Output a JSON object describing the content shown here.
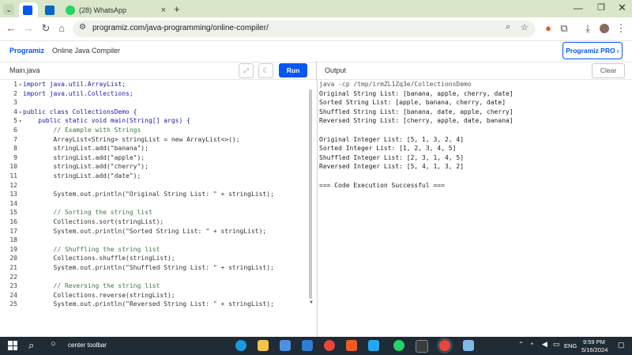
{
  "browser": {
    "tabs": [
      {
        "title": ""
      },
      {
        "title": ""
      },
      {
        "title": "(28) WhatsApp"
      }
    ],
    "new_tab": "+",
    "url": "programiz.com/java-programming/online-compiler/"
  },
  "site": {
    "logo": "Programiz",
    "subtitle": "Online Java Compiler",
    "pro_button": "Programiz PRO ›"
  },
  "editor": {
    "filename": "Main.java",
    "run_label": "Run",
    "lines": [
      {
        "n": "1",
        "fold": "▾",
        "code": "import java.util.ArrayList;"
      },
      {
        "n": "2",
        "fold": "",
        "code": "import java.util.Collections;"
      },
      {
        "n": "3",
        "fold": "",
        "code": ""
      },
      {
        "n": "4",
        "fold": "▾",
        "code": "public class CollectionsDemo {"
      },
      {
        "n": "5",
        "fold": "▾",
        "code": "    public static void main(String[] args) {"
      },
      {
        "n": "6",
        "fold": "",
        "code": "        // Example with Strings"
      },
      {
        "n": "7",
        "fold": "",
        "code": "        ArrayList<String> stringList = new ArrayList<>();"
      },
      {
        "n": "8",
        "fold": "",
        "code": "        stringList.add(\"banana\");"
      },
      {
        "n": "9",
        "fold": "",
        "code": "        stringList.add(\"apple\");"
      },
      {
        "n": "10",
        "fold": "",
        "code": "        stringList.add(\"cherry\");"
      },
      {
        "n": "11",
        "fold": "",
        "code": "        stringList.add(\"date\");"
      },
      {
        "n": "12",
        "fold": "",
        "code": ""
      },
      {
        "n": "13",
        "fold": "",
        "code": "        System.out.println(\"Original String List: \" + stringList);"
      },
      {
        "n": "14",
        "fold": "",
        "code": ""
      },
      {
        "n": "15",
        "fold": "",
        "code": "        // Sorting the string list"
      },
      {
        "n": "16",
        "fold": "",
        "code": "        Collections.sort(stringList);"
      },
      {
        "n": "17",
        "fold": "",
        "code": "        System.out.println(\"Sorted String List: \" + stringList);"
      },
      {
        "n": "18",
        "fold": "",
        "code": ""
      },
      {
        "n": "19",
        "fold": "",
        "code": "        // Shuffling the string list"
      },
      {
        "n": "20",
        "fold": "",
        "code": "        Collections.shuffle(stringList);"
      },
      {
        "n": "21",
        "fold": "",
        "code": "        System.out.println(\"Shuffled String List: \" + stringList);"
      },
      {
        "n": "22",
        "fold": "",
        "code": ""
      },
      {
        "n": "23",
        "fold": "",
        "code": "        // Reversing the string list"
      },
      {
        "n": "24",
        "fold": "",
        "code": "        Collections.reverse(stringList);"
      },
      {
        "n": "25",
        "fold": "",
        "code": "        System.out.println(\"Reversed String List: \" + stringList);"
      }
    ]
  },
  "output": {
    "label": "Output",
    "clear_label": "Clear",
    "lines": [
      "java -cp /tmp/irmZL1Zq3e/CollectionsDemo",
      "Original String List: [banana, apple, cherry, date]",
      "Sorted String List: [apple, banana, cherry, date]",
      "Shuffled String List: [banana, date, apple, cherry]",
      "Reversed String List: [cherry, apple, date, banana]",
      "",
      "Original Integer List: [5, 1, 3, 2, 4]",
      "Sorted Integer List: [1, 2, 3, 4, 5]",
      "Shuffled Integer List: [2, 3, 1, 4, 5]",
      "Reversed Integer List: [5, 4, 1, 3, 2]",
      "",
      "=== Code Execution Successful ==="
    ]
  },
  "taskbar": {
    "search_text": "center toolbar",
    "lang": "ENG",
    "time": "9:59 PM",
    "date": "5/16/2024"
  },
  "colors": {
    "accent": "#0556f3",
    "keyword": "#1a1ab0",
    "comment": "#3a7d44",
    "string": "#2d6a4f"
  }
}
